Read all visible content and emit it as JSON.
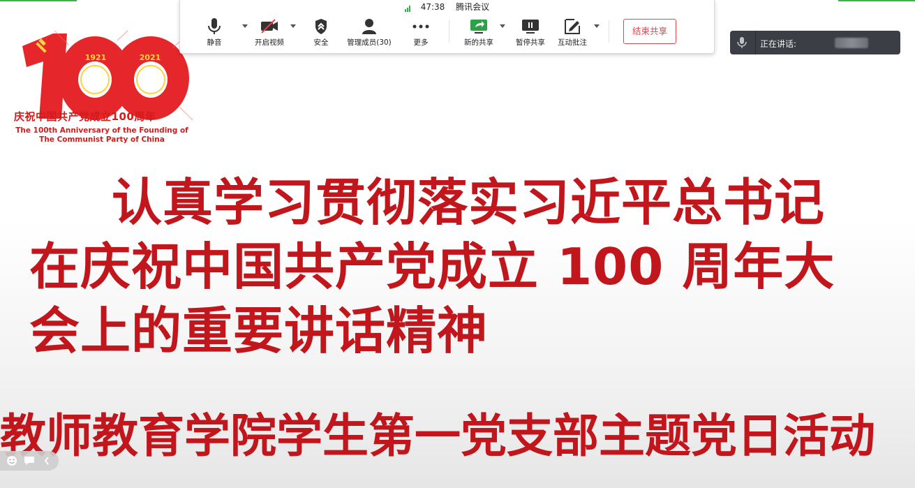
{
  "meeting": {
    "timer": "47:38",
    "app_name": "腾讯会议"
  },
  "toolbar": {
    "mute_label": "静音",
    "video_label": "开启视频",
    "security_label": "安全",
    "members_label": "管理成员(30)",
    "more_label": "更多",
    "new_share_label": "新的共享",
    "pause_share_label": "暂停共享",
    "annotate_label": "互动批注",
    "end_share_label": "结束共享"
  },
  "speaking": {
    "label": "正在讲话:"
  },
  "logo": {
    "year_start": "1921",
    "year_end": "2021",
    "caption_cn": "庆祝中国共产党成立100周年",
    "caption_en_1": "The 100th Anniversary of the Founding of",
    "caption_en_2": "The Communist Party of China"
  },
  "slide": {
    "title_line_1": "认真学习贯彻落实习近平总书记",
    "title_line_2": "在庆祝中国共产党成立 100 周年大",
    "title_line_3": "会上的重要讲话精神",
    "subtitle": "教师教育学院学生第一党支部主题党日活动"
  },
  "colors": {
    "accent_red": "#c1161c",
    "logo_red": "#d31b1b",
    "signal_green": "#27b543",
    "end_share_red": "#e0464c"
  }
}
